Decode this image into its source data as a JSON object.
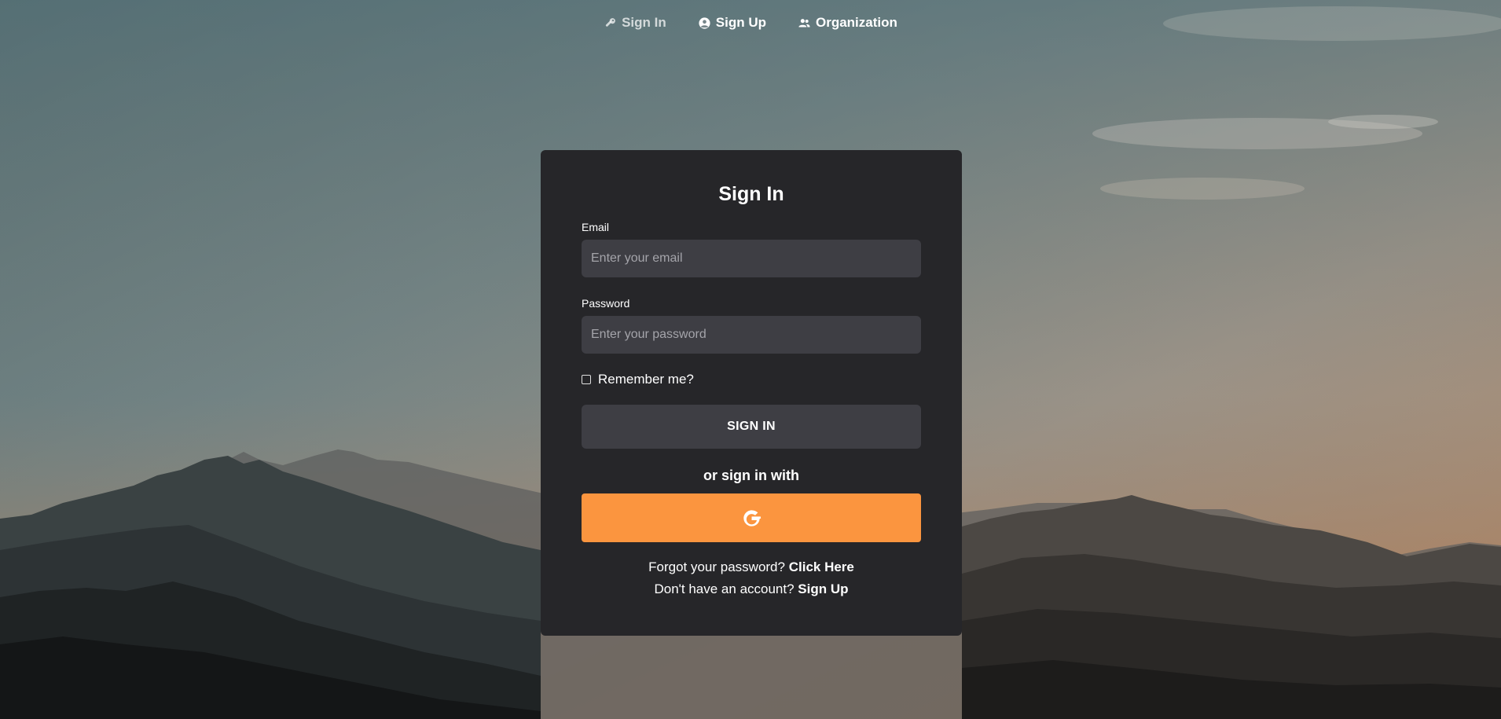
{
  "nav": {
    "items": [
      {
        "label": "Sign In",
        "icon": "key-icon",
        "active": true
      },
      {
        "label": "Sign Up",
        "icon": "user-circle-icon",
        "active": false
      },
      {
        "label": "Organization",
        "icon": "users-icon",
        "active": false
      }
    ]
  },
  "card": {
    "title": "Sign In",
    "email": {
      "label": "Email",
      "placeholder": "Enter your email",
      "value": ""
    },
    "password": {
      "label": "Password",
      "placeholder": "Enter your password",
      "value": ""
    },
    "remember": {
      "label": "Remember me?",
      "checked": false
    },
    "signin_button": "SIGN IN",
    "alt_text": "or sign in with",
    "google_icon": "google-icon",
    "forgot": {
      "text": "Forgot your password?",
      "link": "Click Here"
    },
    "signup": {
      "text": "Don't have an account?",
      "link": "Sign Up"
    }
  },
  "colors": {
    "card_bg": "#262629",
    "input_bg": "#3e3e44",
    "accent": "#fb953f"
  }
}
